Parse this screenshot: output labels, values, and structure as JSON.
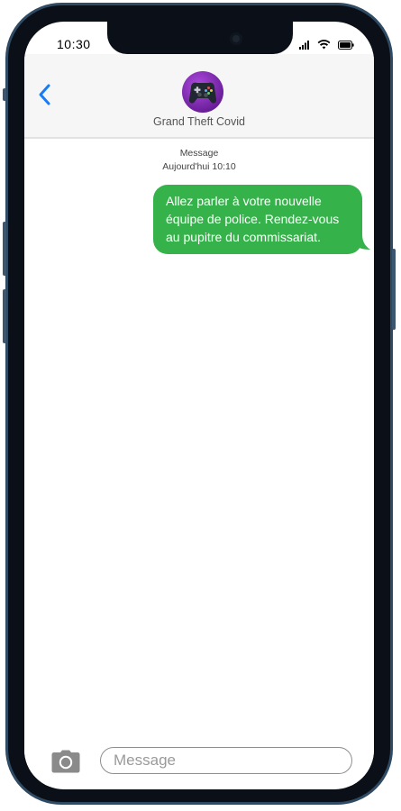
{
  "status_bar": {
    "time": "10:30",
    "icons": [
      "signal-icon",
      "wifi-icon",
      "battery-icon"
    ]
  },
  "header": {
    "back_icon": "chevron-left-icon",
    "avatar_icon": "gamepad-icon",
    "contact_name": "Grand Theft Covid"
  },
  "thread": {
    "service_label": "Message",
    "timestamp": "Aujourd'hui 10:10",
    "messages": [
      {
        "direction": "outgoing",
        "text": "Allez parler à votre nouvelle équipe de police. Rendez-vous au pupitre du commissariat."
      }
    ]
  },
  "composer": {
    "camera_icon": "camera-icon",
    "placeholder": "Message",
    "value": ""
  },
  "colors": {
    "bubble": "#35b34a",
    "accent": "#1a7cf5",
    "frame": "#2f4a63"
  }
}
